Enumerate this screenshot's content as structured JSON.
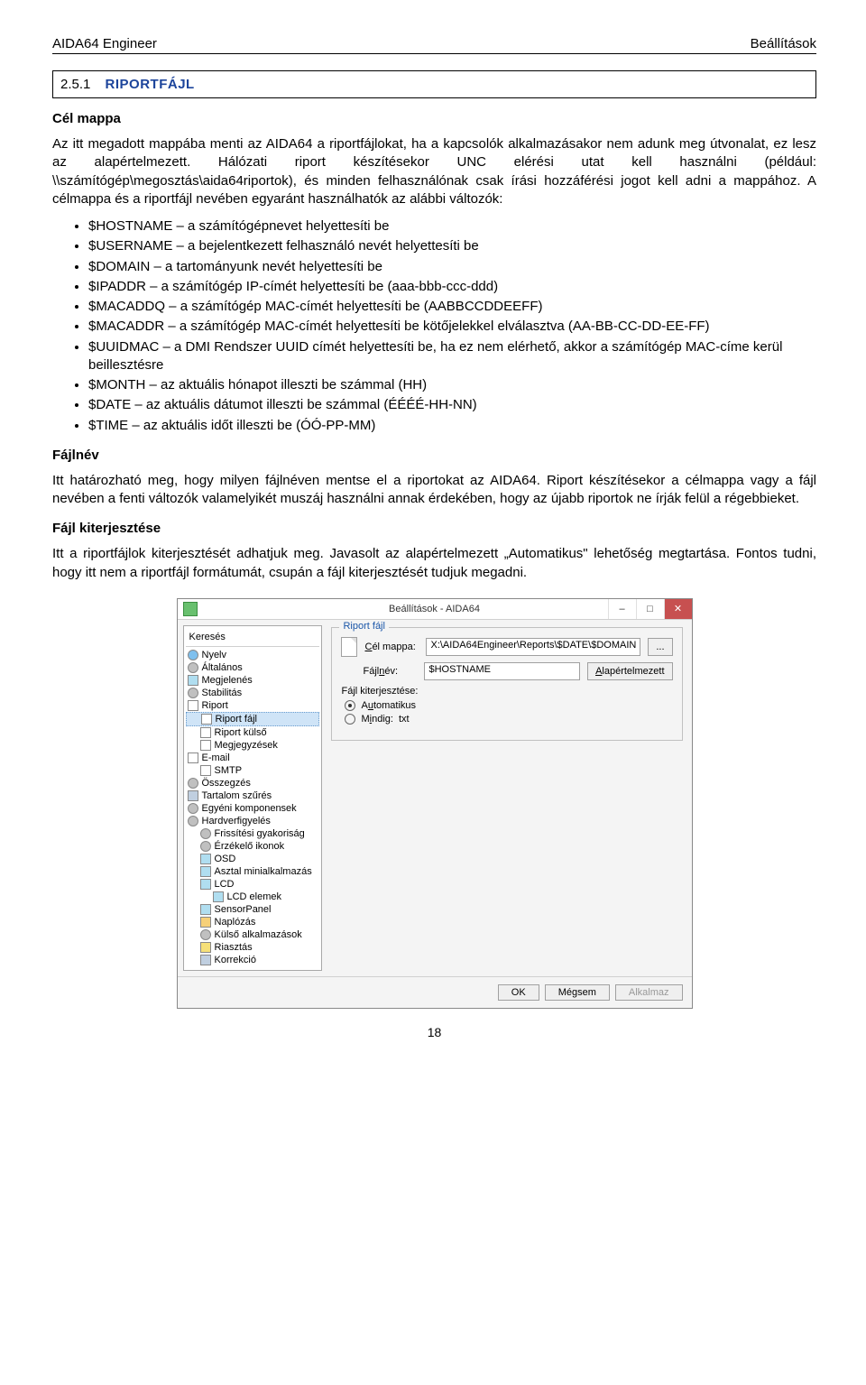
{
  "header": {
    "left": "AIDA64 Engineer",
    "right": "Beállítások"
  },
  "section": {
    "number": "2.5.1",
    "title": "RIPORTFÁJL"
  },
  "subhead1": "Cél mappa",
  "para1": "Az itt megadott mappába menti az AIDA64 a riportfájlokat, ha a kapcsolók alkalmazásakor nem adunk meg útvonalat, ez lesz az alapértelmezett. Hálózati riport készítésekor UNC elérési utat kell használni (például: \\\\számítógép\\megosztás\\aida64riportok), és minden felhasználónak csak írási hozzáférési jogot kell adni a mappához. A célmappa és a riportfájl nevében egyaránt használhatók az alábbi változók:",
  "vars": [
    "$HOSTNAME – a számítógépnevet helyettesíti be",
    "$USERNAME – a bejelentkezett felhasználó nevét helyettesíti be",
    "$DOMAIN – a tartományunk nevét helyettesíti be",
    "$IPADDR – a számítógép IP-címét helyettesíti be (aaa-bbb-ccc-ddd)",
    "$MACADDQ – a számítógép MAC-címét helyettesíti be (AABBCCDDEEFF)",
    "$MACADDR – a számítógép MAC-címét helyettesíti be kötőjelekkel elválasztva (AA-BB-CC-DD-EE-FF)",
    "$UUIDMAC – a DMI Rendszer UUID címét helyettesíti be, ha ez nem elérhető, akkor a számítógép MAC-címe kerül beillesztésre",
    "$MONTH – az aktuális hónapot illeszti be számmal (HH)",
    "$DATE – az aktuális dátumot illeszti be számmal (ÉÉÉÉ-HH-NN)",
    "$TIME – az aktuális időt illeszti be (ÓÓ-PP-MM)"
  ],
  "subhead2": "Fájlnév",
  "para2": "Itt határozható meg, hogy milyen fájlnéven mentse el a riportokat az AIDA64. Riport készítésekor a célmappa vagy a fájl nevében a fenti változók valamelyikét muszáj használni annak érdekében, hogy az újabb riportok ne írják felül a régebbieket.",
  "subhead3": "Fájl kiterjesztése",
  "para3": "Itt a riportfájlok kiterjesztését adhatjuk meg. Javasolt az alapértelmezett „Automatikus\" lehetőség megtartása. Fontos tudni, hogy itt nem a riportfájl formátumát, csupán a fájl kiterjesztését tudjuk megadni.",
  "dialog": {
    "title": "Beállítások - AIDA64",
    "search_label": "Keresés",
    "tree": [
      {
        "i": 0,
        "icon": "globe",
        "label": "Nyelv"
      },
      {
        "i": 0,
        "icon": "gear",
        "label": "Általános"
      },
      {
        "i": 0,
        "icon": "panel",
        "label": "Megjelenés"
      },
      {
        "i": 0,
        "icon": "gear",
        "label": "Stabilitás"
      },
      {
        "i": 0,
        "icon": "file",
        "label": "Riport"
      },
      {
        "i": 1,
        "icon": "file",
        "label": "Riport fájl",
        "selected": true
      },
      {
        "i": 1,
        "icon": "file",
        "label": "Riport külső"
      },
      {
        "i": 1,
        "icon": "file",
        "label": "Megjegyzések"
      },
      {
        "i": 0,
        "icon": "file",
        "label": "E-mail"
      },
      {
        "i": 1,
        "icon": "file",
        "label": "SMTP"
      },
      {
        "i": 0,
        "icon": "gear",
        "label": "Összegzés"
      },
      {
        "i": 0,
        "icon": "wrench",
        "label": "Tartalom szűrés"
      },
      {
        "i": 0,
        "icon": "gear",
        "label": "Egyéni komponensek"
      },
      {
        "i": 0,
        "icon": "gear",
        "label": "Hardverfigyelés"
      },
      {
        "i": 1,
        "icon": "gear",
        "label": "Frissítési gyakoriság"
      },
      {
        "i": 1,
        "icon": "gear",
        "label": "Érzékelő ikonok"
      },
      {
        "i": 1,
        "icon": "panel",
        "label": "OSD"
      },
      {
        "i": 1,
        "icon": "panel",
        "label": "Asztal minialkalmazás"
      },
      {
        "i": 1,
        "icon": "panel",
        "label": "LCD"
      },
      {
        "i": 2,
        "icon": "panel",
        "label": "LCD elemek"
      },
      {
        "i": 1,
        "icon": "panel",
        "label": "SensorPanel"
      },
      {
        "i": 1,
        "icon": "folder",
        "label": "Naplózás"
      },
      {
        "i": 1,
        "icon": "gear",
        "label": "Külső alkalmazások"
      },
      {
        "i": 1,
        "icon": "bell",
        "label": "Riasztás"
      },
      {
        "i": 1,
        "icon": "wrench",
        "label": "Korrekció"
      }
    ],
    "pane": {
      "group_title": "Riport fájl",
      "target_label_html": "<u>C</u>él mappa:",
      "target_value": "X:\\AIDA64Engineer\\Reports\\$DATE\\$DOMAIN",
      "browse_btn": "...",
      "name_label_html": "Fájl<u>n</u>év:",
      "name_value": "$HOSTNAME",
      "default_btn_html": "<u>A</u>lapértelmezett",
      "ext_legend": "Fájl kiterjesztése:",
      "radio_auto_html": "A<u>u</u>tomatikus",
      "radio_custom_html": "M<u>i</u>ndig:",
      "custom_value": "txt"
    },
    "buttons": {
      "ok": "OK",
      "cancel": "Mégsem",
      "apply": "Alkalmaz"
    }
  },
  "page_number": "18"
}
